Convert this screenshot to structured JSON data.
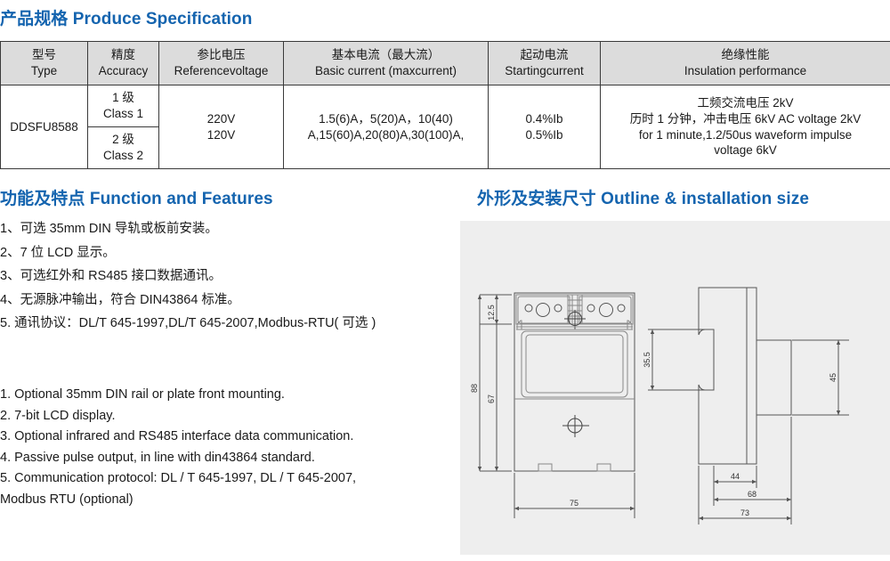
{
  "sections": {
    "spec_title": "产品规格 Produce Specification",
    "features_title": "功能及特点 Function and Features",
    "outline_title": "外形及安装尺寸 Outline & installation size"
  },
  "colors": {
    "heading": "#1464af",
    "table_header_bg": "#dcdcdc",
    "table_border": "#3a3a3a",
    "panel_bg": "#eeeeee",
    "drawing_line": "#555555"
  },
  "spec_table": {
    "headers": [
      {
        "cn": "型号",
        "en": "Type"
      },
      {
        "cn": "精度",
        "en": "Accuracy"
      },
      {
        "cn": "参比电压",
        "en": "Referencevoltage"
      },
      {
        "cn": "基本电流（最大流）",
        "en": "Basic current (maxcurrent)"
      },
      {
        "cn": "起动电流",
        "en": "Startingcurrent"
      },
      {
        "cn": "绝缘性能",
        "en": "Insulation performance"
      }
    ],
    "model": "DDSFU8588",
    "accuracy": [
      {
        "cn": "1 级",
        "en": "Class 1"
      },
      {
        "cn": "2 级",
        "en": "Class 2"
      }
    ],
    "reference_voltage": [
      "220V",
      "120V"
    ],
    "basic_current": [
      "1.5(6)A，5(20)A，10(40)",
      "A,15(60)A,20(80)A,30(100)A,"
    ],
    "starting_current": [
      "0.4%Ib",
      "0.5%Ib"
    ],
    "insulation": [
      "工频交流电压 2kV",
      "历时 1 分钟，冲击电压 6kV  AC voltage 2kV",
      "for 1 minute,1.2/50us waveform impulse",
      "voltage 6kV"
    ]
  },
  "features_cn": [
    "1、可选 35mm DIN 导轨或板前安装。",
    "2、7 位 LCD 显示。",
    "3、可选红外和 RS485 接口数据通讯。",
    "4、无源脉冲输出，符合 DIN43864 标准。",
    "5. 通讯协议：DL/T 645-1997,DL/T 645-2007,Modbus-RTU( 可选 )"
  ],
  "features_en": [
    "1. Optional 35mm DIN rail or plate front mounting.",
    "2. 7-bit LCD display.",
    "3. Optional infrared and RS485 interface data communication.",
    "4. Passive pulse output, in line with din43864 standard.",
    "5. Communication  protocol: DL / T 645-1997, DL / T 645-2007,",
    "Modbus RTU (optional)"
  ],
  "drawing": {
    "front_view_dimensions": {
      "d_12_5": "12.5",
      "d_88": "88",
      "d_67": "67",
      "d_75": "75"
    },
    "side_view_dimensions": {
      "d_35_5": "35.5",
      "d_45": "45",
      "d_44": "44",
      "d_68": "68",
      "d_73": "73"
    }
  }
}
